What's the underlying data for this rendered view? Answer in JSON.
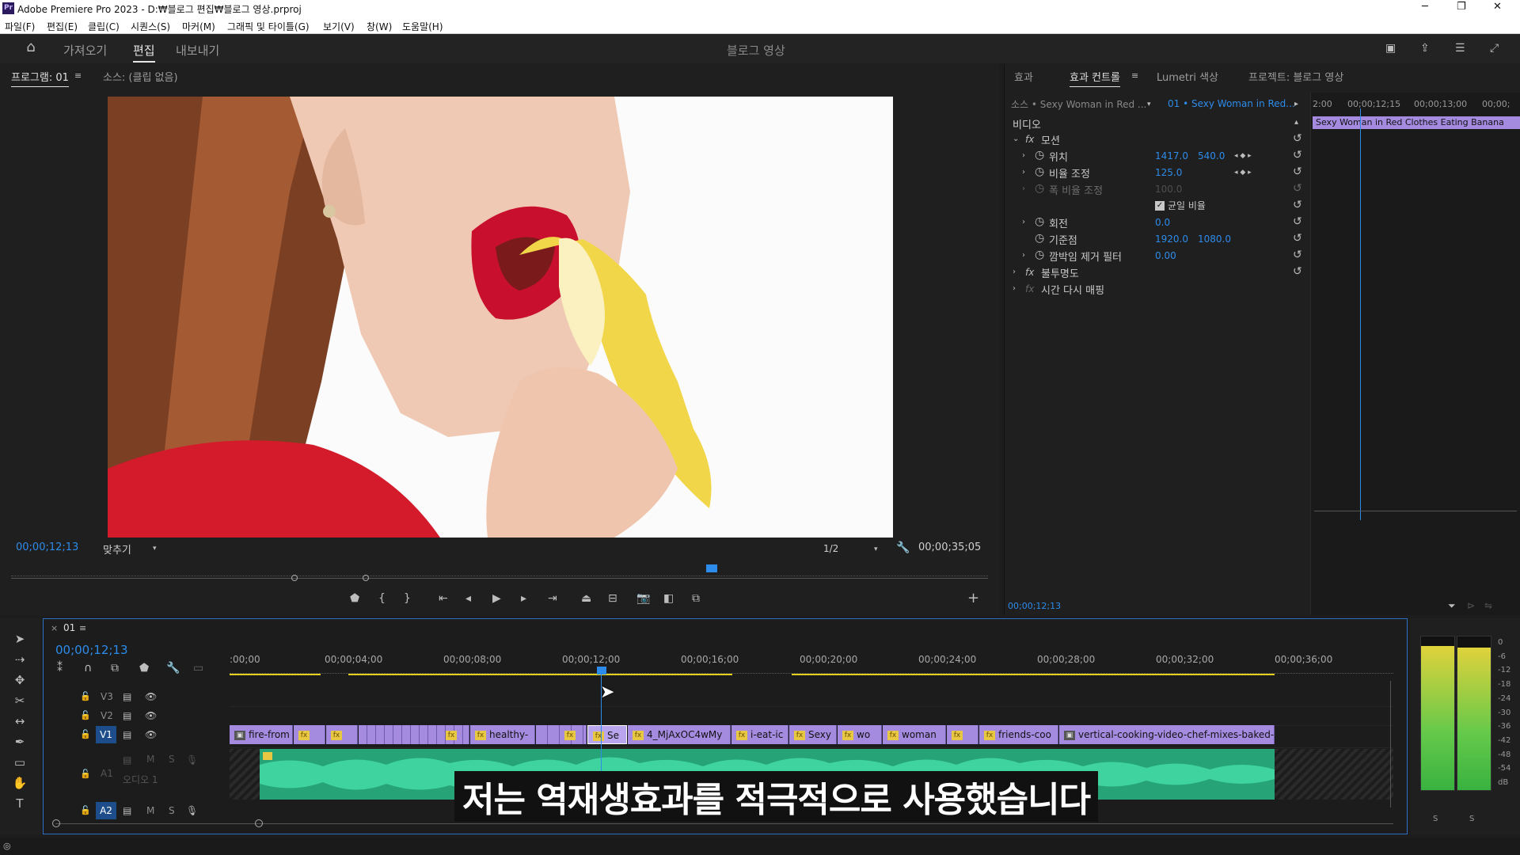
{
  "app": {
    "title": "Adobe Premiere Pro 2023 - D:₩블로그 편집₩블로그 영상.prproj",
    "logo_text": "Pr",
    "window_controls": [
      "─",
      "❐",
      "✕"
    ]
  },
  "menu": [
    "파일(F)",
    "편집(E)",
    "클립(C)",
    "시퀀스(S)",
    "마커(M)",
    "그래픽 및 타이틀(G)",
    "보기(V)",
    "창(W)",
    "도움말(H)"
  ],
  "workspace": {
    "tabs": [
      "가져오기",
      "편집",
      "내보내기"
    ],
    "active_tab": "편집",
    "project_name": "블로그 영상"
  },
  "program_monitor": {
    "tab_program": "프로그램: 01",
    "tab_source": "소스: (클립 없음)",
    "timecode": "00;00;12;13",
    "zoom": "맞추기",
    "resolution": "1/2",
    "duration": "00;00;35;05",
    "subtitle": "저는 역재생효과를 적극적으로 사용했습니다"
  },
  "effect_controls": {
    "tabs": [
      "효과",
      "효과 컨트롤",
      "Lumetri 색상",
      "프로젝트: 블로그 영상"
    ],
    "source_label": "소스 • Sexy Woman in Red ...",
    "sequence_label": "01 • Sexy Woman in Red...",
    "section_video": "비디오",
    "motion": "모션",
    "props": [
      {
        "name": "위치",
        "v1": "1417.0",
        "v2": "540.0"
      },
      {
        "name": "비율 조정",
        "v1": "125.0",
        "v2": ""
      },
      {
        "name": "폭 비율 조정",
        "v1": "100.0",
        "v2": ""
      },
      {
        "name": "균일 비율",
        "v1": "",
        "v2": ""
      },
      {
        "name": "회전",
        "v1": "0.0",
        "v2": ""
      },
      {
        "name": "기준점",
        "v1": "1920.0",
        "v2": "1080.0"
      },
      {
        "name": "깜박임 제거 필터",
        "v1": "0.00",
        "v2": ""
      }
    ],
    "opacity": "불투명도",
    "time_remap": "시간 다시 매핑",
    "mini_ruler": [
      "2:00",
      "00;00;12;15",
      "00;00;13;00",
      "00;00;"
    ],
    "mini_clip": "Sexy Woman in Red Clothes Eating Banana",
    "timecode": "00;00;12;13"
  },
  "timeline": {
    "seq_tab": "01",
    "timecode": "00;00;12;13",
    "ruler": [
      ":00;00",
      "00;00;04;00",
      "00;00;08;00",
      "00;00;12;00",
      "00;00;16;00",
      "00;00;20;00",
      "00;00;24;00",
      "00;00;28;00",
      "00;00;32;00",
      "00;00;36;00"
    ],
    "tracks": [
      "V3",
      "V2",
      "V1",
      "A1",
      "A2"
    ],
    "a1_name": "오디오 1",
    "clips": [
      {
        "label": "fire-from"
      },
      {
        "label": ""
      },
      {
        "label": ""
      },
      {
        "label": ""
      },
      {
        "label": "healthy-"
      },
      {
        "label": ""
      },
      {
        "label": "Se"
      },
      {
        "label": "4_MjAxOC4wMy"
      },
      {
        "label": "i-eat-ic"
      },
      {
        "label": "Sexy"
      },
      {
        "label": "wo"
      },
      {
        "label": "woman"
      },
      {
        "label": ""
      },
      {
        "label": "friends-coo"
      },
      {
        "label": "vertical-cooking-video-chef-mixes-baked-pe"
      }
    ]
  },
  "meter": {
    "scale": [
      "0",
      "-6",
      "-12",
      "-18",
      "-24",
      "-30",
      "-36",
      "-42",
      "-48",
      "-54",
      "dB"
    ],
    "solo": [
      "S",
      "S"
    ]
  },
  "colors": {
    "accent": "#2d8ceb",
    "clip": "#a48be0",
    "audio": "#2fbf8f",
    "work_area": "#e5d21f"
  }
}
